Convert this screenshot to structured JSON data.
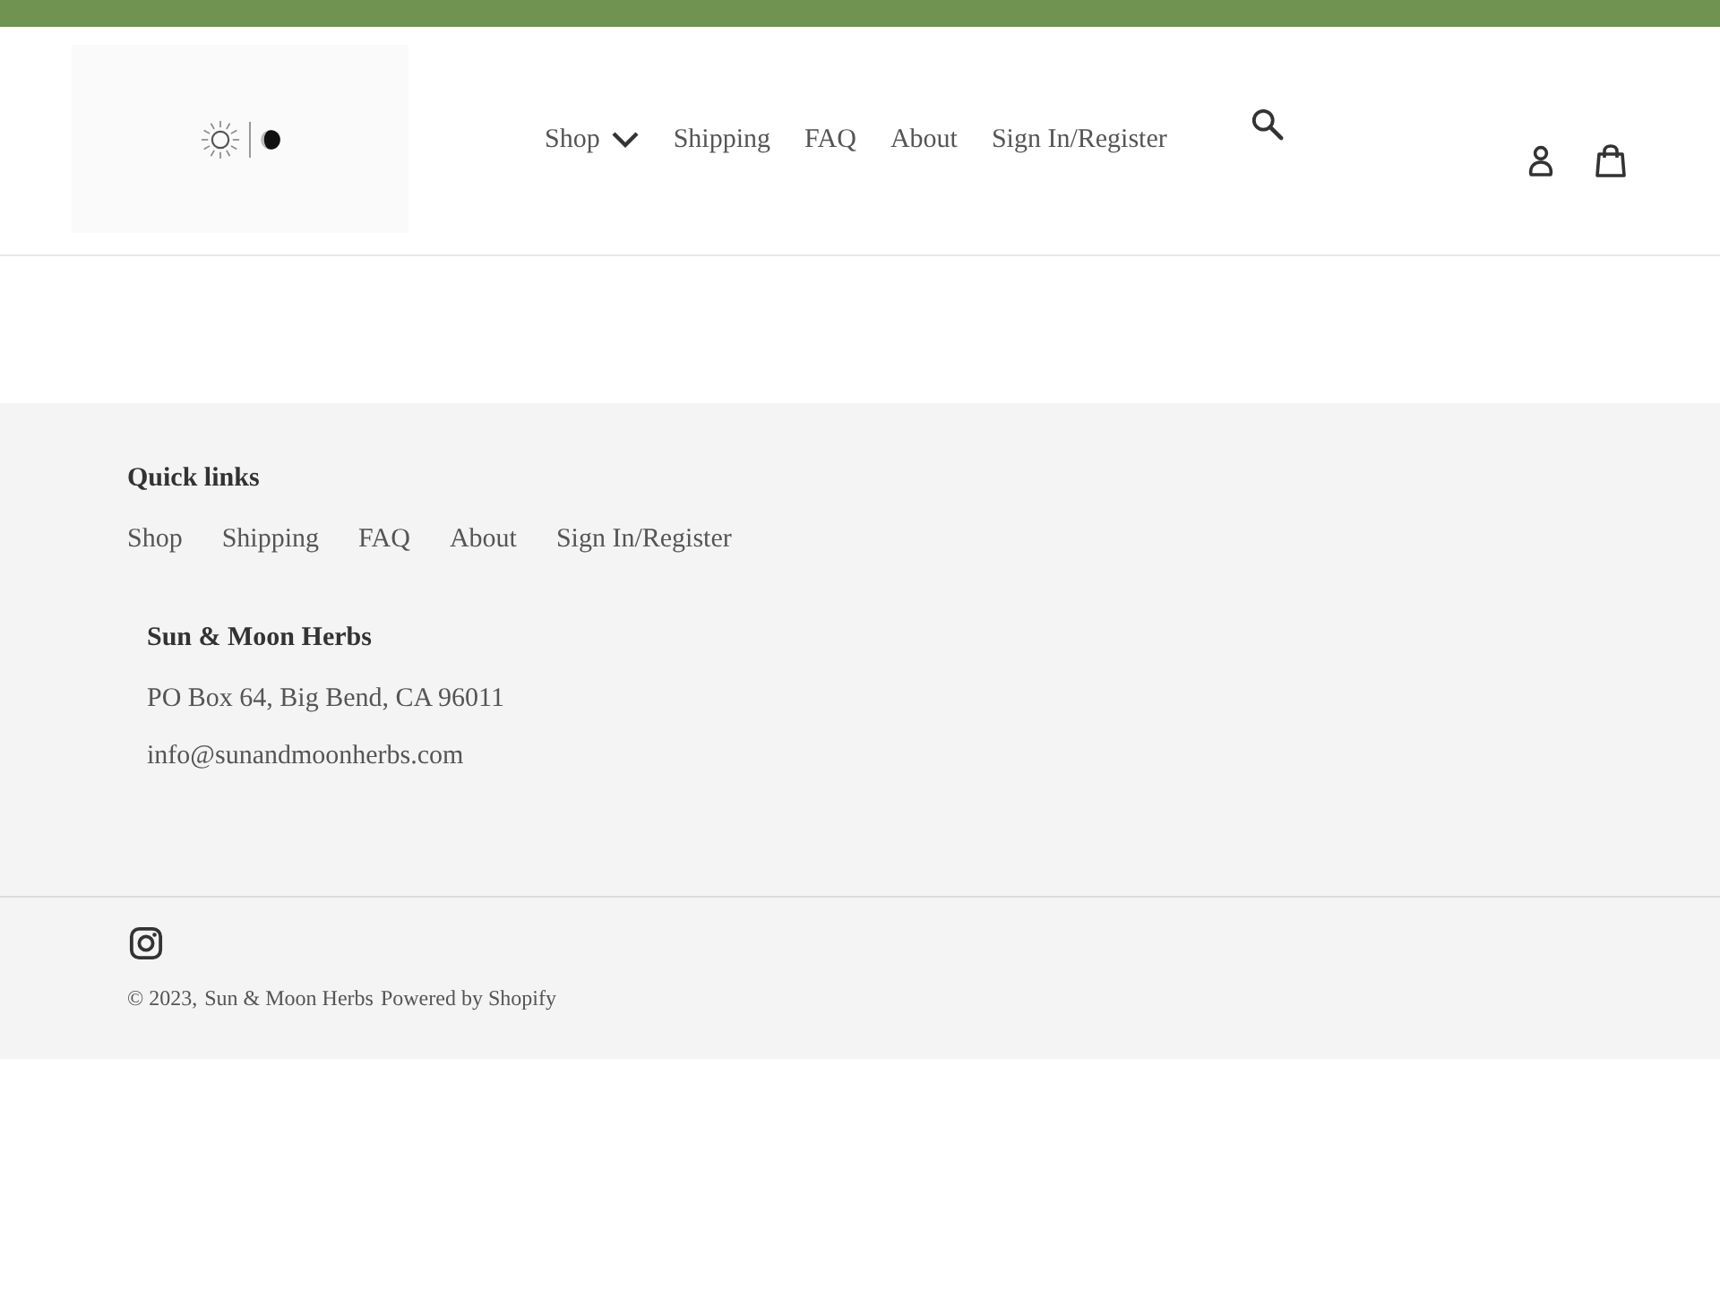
{
  "header": {
    "nav": [
      {
        "label": "Shop",
        "dropdown": true
      },
      {
        "label": "Shipping",
        "dropdown": false
      },
      {
        "label": "FAQ",
        "dropdown": false
      },
      {
        "label": "About",
        "dropdown": false
      },
      {
        "label": "Sign In/Register",
        "dropdown": false
      }
    ]
  },
  "footer": {
    "quick_links": {
      "title": "Quick links",
      "links": [
        "Shop",
        "Shipping",
        "FAQ",
        "About",
        "Sign In/Register"
      ]
    },
    "contact": {
      "name": "Sun & Moon Herbs",
      "address": "PO Box 64, Big Bend, CA 96011",
      "email": "info@sunandmoonherbs.com"
    },
    "copyright": {
      "text": "© 2023,",
      "store_link": "Sun & Moon Herbs",
      "powered_by": "Powered by Shopify"
    }
  }
}
